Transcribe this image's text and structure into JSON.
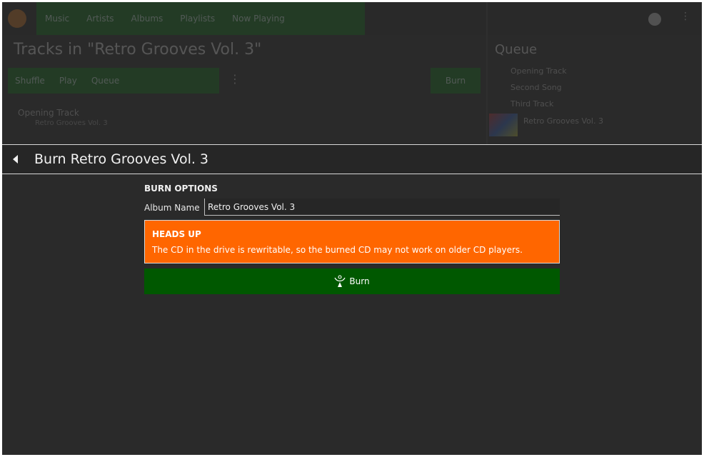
{
  "background": {
    "nav_items": [
      "Music",
      "Artists",
      "Albums",
      "Playlists",
      "Now Playing"
    ],
    "page_title": "Tracks in \"Retro Grooves Vol. 3\"",
    "actions": [
      "Shuffle",
      "Play",
      "Queue"
    ],
    "action_button": "Burn",
    "track_title": "Opening Track",
    "track_subtitle": "Retro Grooves Vol. 3",
    "queue_title": "Queue",
    "queue_items": [
      "Opening Track",
      "Second Song",
      "Third Track",
      "Retro Grooves Vol. 3"
    ]
  },
  "sheet": {
    "title": "Burn Retro Grooves Vol. 3",
    "section_title": "BURN OPTIONS",
    "album_name_label": "Album Name",
    "album_name_value": "Retro Grooves Vol. 3",
    "warning_title": "HEADS UP",
    "warning_text": "The CD in the drive is rewritable, so the burned CD may not work on older CD players.",
    "burn_label": "Burn",
    "icons": {
      "back": "back-arrow-icon",
      "burn": "burn-disc-icon"
    }
  },
  "colors": {
    "warning_bg": "#ff6600",
    "burn_bg": "#005800",
    "surface": "#2a2a2a"
  }
}
